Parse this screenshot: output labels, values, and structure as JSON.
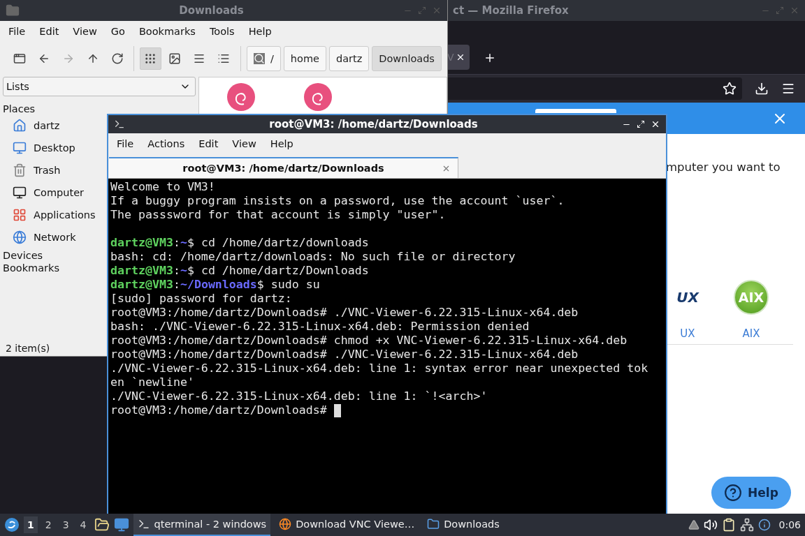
{
  "firefox": {
    "title": "ct — Mozilla Firefox",
    "tab_text": "V",
    "page": {
      "text": "mputer you want to",
      "platforms": [
        {
          "logo": "UX",
          "label": "UX"
        },
        {
          "logo": "AIX",
          "label": "AIX"
        }
      ],
      "help": "Help"
    }
  },
  "file_manager": {
    "title": "Downloads",
    "menu": [
      "File",
      "Edit",
      "View",
      "Go",
      "Bookmarks",
      "Tools",
      "Help"
    ],
    "nav_buttons": [
      {
        "disabled": false
      },
      {
        "disabled": false
      },
      {
        "disabled": true
      },
      {
        "disabled": false
      },
      {
        "disabled": false
      }
    ],
    "view_modes": [
      {
        "selected": true
      },
      {
        "selected": false
      },
      {
        "selected": false
      },
      {
        "selected": false
      }
    ],
    "path": {
      "root": "/",
      "crumbs": [
        {
          "label": "home",
          "selected": false
        },
        {
          "label": "dartz",
          "selected": false
        },
        {
          "label": "Downloads",
          "selected": true
        }
      ]
    },
    "side_mode": "Lists",
    "sections": [
      {
        "title": "Places",
        "items": [
          "dartz",
          "Desktop",
          "Trash",
          "Computer",
          "Applications",
          "Network"
        ]
      },
      {
        "title": "Devices"
      },
      {
        "title": "Bookmarks"
      }
    ],
    "files": [
      {
        "kind": "package"
      },
      {
        "kind": "package"
      }
    ],
    "status": "2 item(s)"
  },
  "terminal": {
    "title": "root@VM3: /home/dartz/Downloads",
    "menu": [
      "File",
      "Actions",
      "Edit",
      "View",
      "Help"
    ],
    "tab": {
      "label": "root@VM3: /home/dartz/Downloads",
      "selected": true
    },
    "lines": [
      {
        "segments": [
          {
            "text": "Welcome to VM3!"
          }
        ]
      },
      {
        "segments": [
          {
            "text": "If a buggy program insists on a password, use the account `user`."
          }
        ]
      },
      {
        "segments": [
          {
            "text": "The passsword for that account is simply \"user\"."
          }
        ]
      },
      {
        "kind": "blank"
      },
      {
        "segments": [
          {
            "text": "dartz@VM3",
            "kind": "user"
          },
          {
            "text": ":"
          },
          {
            "text": "~",
            "kind": "path"
          },
          {
            "text": "$ cd /home/dartz/downloads"
          }
        ]
      },
      {
        "segments": [
          {
            "text": "bash: cd: /home/dartz/downloads: No such file or directory"
          }
        ]
      },
      {
        "segments": [
          {
            "text": "dartz@VM3",
            "kind": "user"
          },
          {
            "text": ":"
          },
          {
            "text": "~",
            "kind": "path"
          },
          {
            "text": "$ cd /home/dartz/Downloads"
          }
        ]
      },
      {
        "segments": [
          {
            "text": "dartz@VM3",
            "kind": "user"
          },
          {
            "text": ":"
          },
          {
            "text": "~/Downloads",
            "kind": "path"
          },
          {
            "text": "$ sudo su"
          }
        ]
      },
      {
        "segments": [
          {
            "text": "[sudo] password for dartz:"
          }
        ]
      },
      {
        "segments": [
          {
            "text": "root@VM3:/home/dartz/Downloads# ./VNC-Viewer-6.22.315-Linux-x64.deb"
          }
        ]
      },
      {
        "segments": [
          {
            "text": "bash: ./VNC-Viewer-6.22.315-Linux-x64.deb: Permission denied"
          }
        ]
      },
      {
        "segments": [
          {
            "text": "root@VM3:/home/dartz/Downloads# chmod +x VNC-Viewer-6.22.315-Linux-x64.deb"
          }
        ]
      },
      {
        "segments": [
          {
            "text": "root@VM3:/home/dartz/Downloads# ./VNC-Viewer-6.22.315-Linux-x64.deb"
          }
        ]
      },
      {
        "segments": [
          {
            "text": "./VNC-Viewer-6.22.315-Linux-x64.deb: line 1: syntax error near unexpected tok"
          }
        ]
      },
      {
        "segments": [
          {
            "text": "en `newline'"
          }
        ]
      },
      {
        "segments": [
          {
            "text": "./VNC-Viewer-6.22.315-Linux-x64.deb: line 1: `!<arch>'"
          }
        ]
      },
      {
        "segments": [
          {
            "text": "root@VM3:/home/dartz/Downloads#"
          }
        ],
        "cursor": true
      }
    ]
  },
  "taskbar": {
    "workspaces": [
      {
        "label": "1",
        "selected": true
      },
      {
        "label": "2",
        "selected": false
      },
      {
        "label": "3",
        "selected": false
      },
      {
        "label": "4",
        "selected": false
      }
    ],
    "tasks": [
      {
        "label": "qterminal - 2 windows",
        "selected": true
      },
      {
        "label": "Download VNC Viewe…",
        "selected": false
      },
      {
        "label": "Downloads",
        "selected": false
      }
    ],
    "clock": "0:06"
  }
}
